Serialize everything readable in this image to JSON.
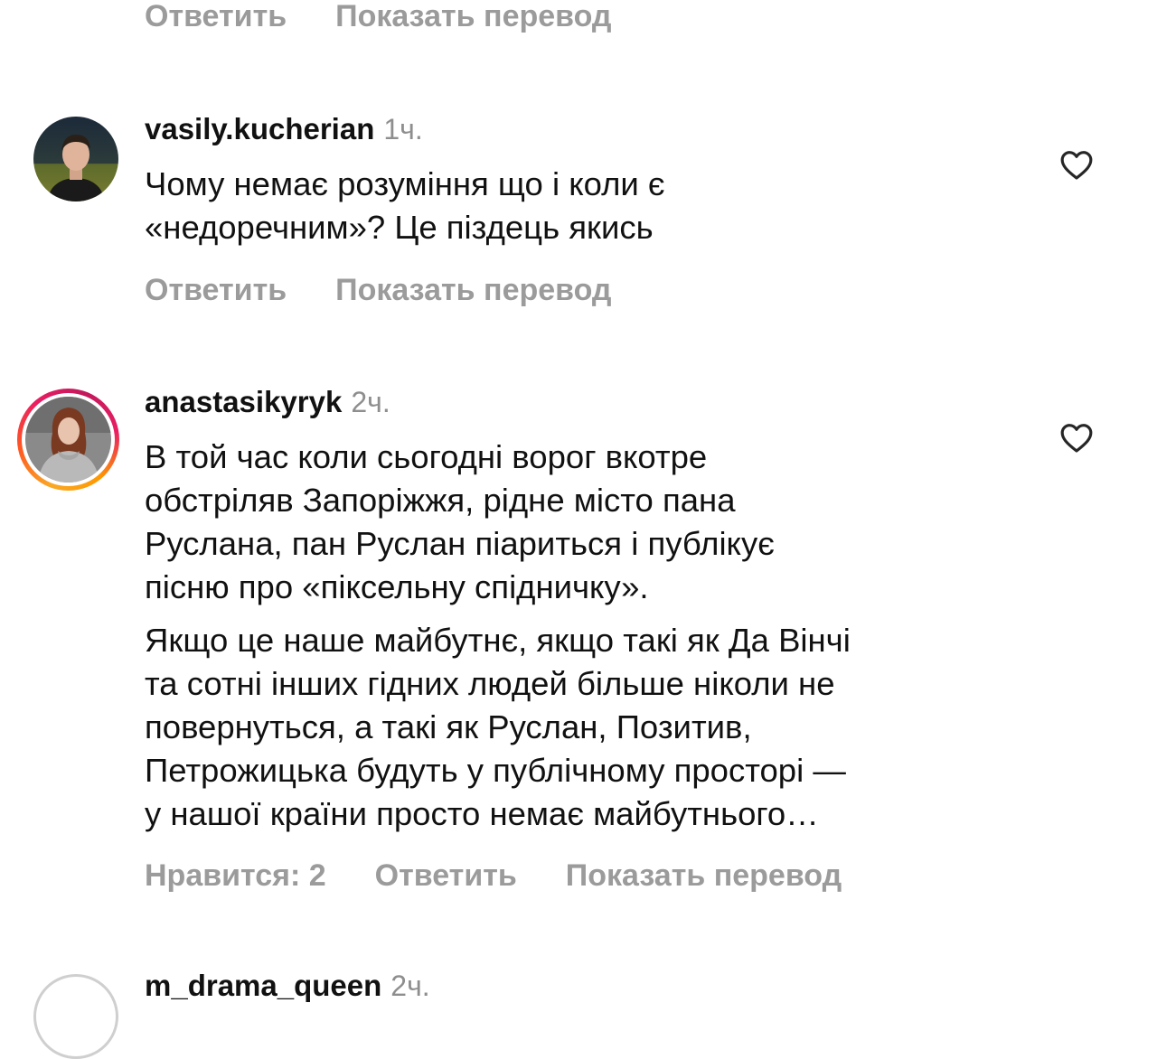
{
  "top_actions": {
    "reply": "Ответить",
    "translate": "Показать перевод"
  },
  "comments": [
    {
      "username": "vasily.kucherian",
      "time": "1ч.",
      "text": "Чому немає розуміння що і коли є\n«недоречним»? Це піздець якись",
      "actions": {
        "reply": "Ответить",
        "translate": "Показать перевод"
      },
      "like_icon": "heart-outline-icon"
    },
    {
      "username": "anastasikyryk",
      "time": "2ч.",
      "paragraph1": "В той час коли сьогодні ворог вкотре\nобстріляв Запоріжжя, рідне місто пана\nРуслана, пан Руслан піариться і публікує\nпісню про «піксельну спідничку».",
      "paragraph2": "Якщо це наше майбутнє, якщо такі як Да Вінчі\nта сотні інших гідних людей більше ніколи не\nповернуться, а такі як Руслан, Позитив,\nПетрожицька будуть у публічному просторі —\nу нашої країни просто немає майбутнього…",
      "actions": {
        "likes": "Нравится: 2",
        "reply": "Ответить",
        "translate": "Показать перевод"
      },
      "story_ring": true,
      "like_icon": "heart-outline-icon"
    },
    {
      "username": "m_drama_queen",
      "time": "2ч."
    }
  ],
  "colors": {
    "text": "#111111",
    "secondary": "#9b9b9b",
    "time": "#8e8e8e",
    "background": "#ffffff"
  }
}
